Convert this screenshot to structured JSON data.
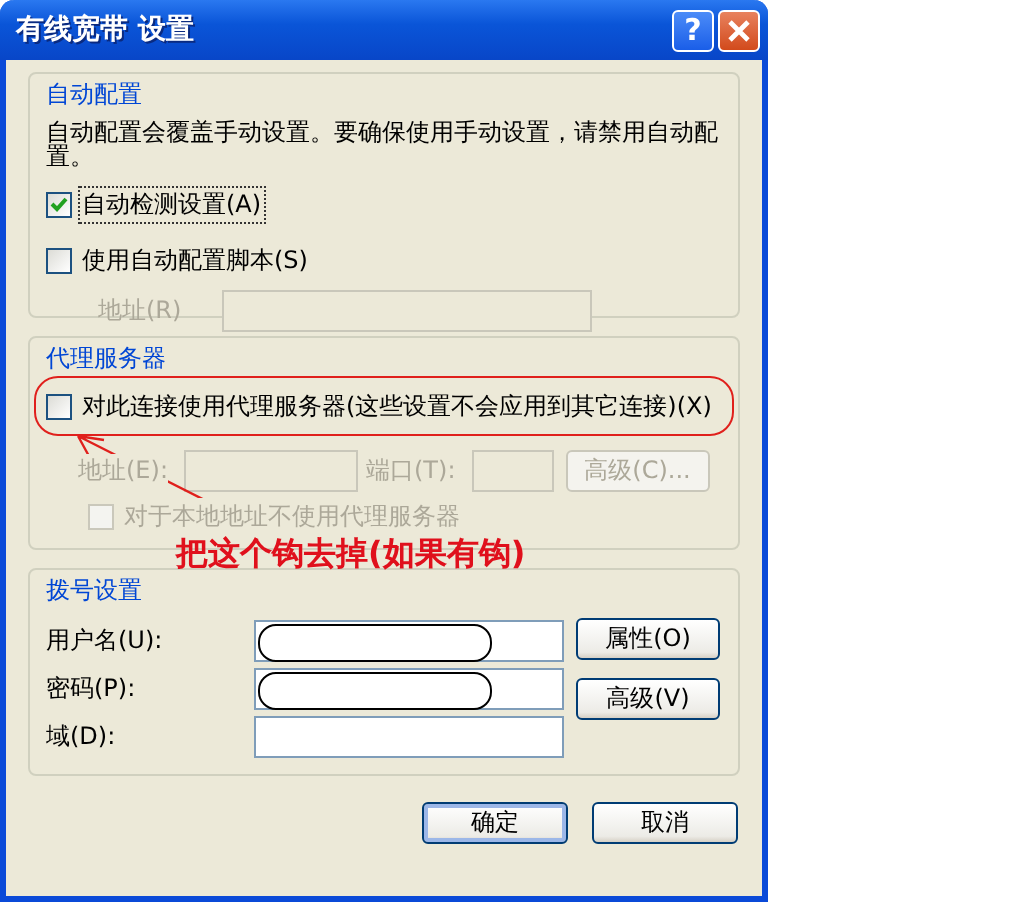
{
  "window": {
    "title": "有线宽带 设置",
    "help": "?"
  },
  "auto_config": {
    "legend": "自动配置",
    "description": "自动配置会覆盖手动设置。要确保使用手动设置，请禁用自动配置。",
    "options": [
      {
        "label": "自动检测设置(A)",
        "checked": true,
        "focused": true
      },
      {
        "label": "使用自动配置脚本(S)",
        "checked": false,
        "focused": false
      }
    ],
    "address": {
      "label": "地址(R)",
      "disabled": true
    }
  },
  "proxy": {
    "legend": "代理服务器",
    "use_proxy": {
      "label": "对此连接使用代理服务器(这些设置不会应用到其它连接)(X)",
      "checked": false
    },
    "disabled": true,
    "address_label": "地址(E):",
    "port_label": "端口(T):",
    "advanced_button": "高级(C)...",
    "bypass": {
      "label": "对于本地地址不使用代理服务器",
      "checked": false
    }
  },
  "dialing": {
    "legend": "拨号设置",
    "fields": [
      {
        "label": "用户名(U):",
        "redacted": true
      },
      {
        "label": "密码(P):",
        "redacted": true
      },
      {
        "label": "域(D):",
        "redacted": false
      }
    ],
    "buttons": [
      "属性(O)",
      "高级(V)"
    ]
  },
  "footer_buttons": [
    {
      "label": "确定",
      "default": true
    },
    {
      "label": "取消",
      "default": false
    }
  ],
  "annotation": {
    "text": "把这个钩去掉(如果有钩)"
  }
}
